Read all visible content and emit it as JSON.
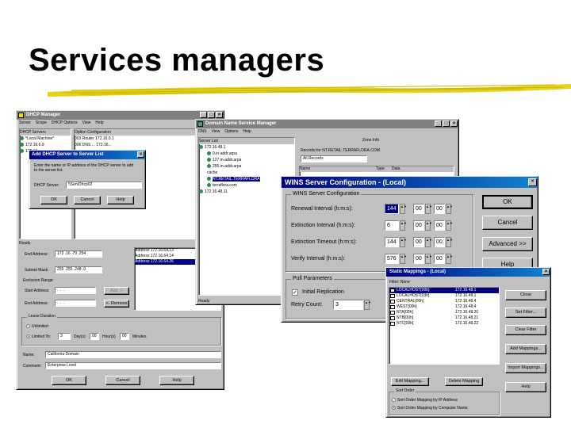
{
  "slide": {
    "title": "Services managers"
  },
  "dhcp": {
    "title": "DHCP Manager",
    "menu": [
      "Server",
      "Scope",
      "DHCP Options",
      "View",
      "Help"
    ],
    "pane_left": "DHCP Servers",
    "pane_right": "Option Configuration",
    "tree": [
      "*Local Machine*",
      "172.16.6.9",
      "172.16..."
    ],
    "options": [
      "003 Router 172.16.0.1",
      "006 DNS ... 172.16..."
    ],
    "status": "Ready",
    "end_address_label": "End Address:",
    "end_address": "172 .16 .79 .254",
    "subnet_label": "Subnet Mask:",
    "subnet": "255 .255 .248 .0",
    "exclusion_label": "Exclusion Range:",
    "start_label": "Start Address:",
    "end_label": "End Address:",
    "add": "Add ->",
    "remove": "<- Remove",
    "excluded": [
      "Address 172.16.64.13",
      "Address 172.16.64.14",
      "Address 172.16.64.26"
    ],
    "lease_label": "Lease Duration",
    "unlimited": "Unlimited",
    "limited": "Limited To:",
    "days": "3",
    "days_label": "Day(s)",
    "hours": "00",
    "hours_label": "Hour(s)",
    "minutes": "00",
    "minutes_label": "Minutes",
    "name_label": "Name:",
    "name": "California Domain",
    "comment_label": "Comment:",
    "comment": "Enterprise Level",
    "ok": "OK",
    "cancel": "Cancel",
    "help": "Help"
  },
  "add_dialog": {
    "title": "Add DHCP Server to Server List",
    "text": "Enter the name or IP address of the DHCP server to add to the server list.",
    "label": "DHCP Server:",
    "value": "\\\\ServDhcp02",
    "ok": "OK",
    "cancel": "Cancel",
    "help": "Help"
  },
  "dns": {
    "title": "Domain Name Service Manager",
    "menu": [
      "DNS",
      "View",
      "Options",
      "Help"
    ],
    "server_list": "Server List",
    "zone_info": "Zone Info",
    "tree": [
      "172.16.48.1",
      "0.in-addr.arpa",
      "127.in-addr.arpa",
      "255.in-addr.arpa",
      "cache",
      "NT.RETAIL.TERRAFLORA",
      "terraflora.com",
      "172.16.48.11"
    ],
    "records_for": "Records for NT.RETAIL.TERRAFLORA.COM",
    "all_records": "All Records",
    "col_name": "Name",
    "col_type": "Type",
    "col_data": "Data",
    "status": "Ready"
  },
  "wins": {
    "title": "WINS Server Configuration - (Local)",
    "group": "WINS Server Configuration",
    "renewal_label": "Renewal Interval (h:m:s):",
    "renewal": [
      "144",
      "00",
      "00"
    ],
    "extinction_label": "Extinction Interval (h:m:s):",
    "extinction": [
      "6",
      "00",
      "00"
    ],
    "timeout_label": "Extinction Timeout (h:m:s):",
    "timeout": [
      "144",
      "00",
      "00"
    ],
    "verify_label": "Verify Interval (h:m:s):",
    "verify": [
      "576",
      "00",
      "00"
    ],
    "pull_group": "Pull Parameters",
    "initial_label": "Initial Replication",
    "retry_label": "Retry Count:",
    "retry": "3",
    "ok": "OK",
    "cancel": "Cancel",
    "advanced": "Advanced >>",
    "help": "Help"
  },
  "static": {
    "title": "Static Mappings - (Local)",
    "filter": "Filter: None",
    "rows": [
      {
        "name": "LOCALHOST[00h]",
        "ip": "172.16.48.1"
      },
      {
        "name": "LOCALHOST[03h]",
        "ip": "172.16.48.1"
      },
      {
        "name": "CENTRAL[00h]",
        "ip": "172.16.48.4"
      },
      {
        "name": "WEST[00h]",
        "ip": "172.16.48.4"
      },
      {
        "name": "NTA[00h]",
        "ip": "172.16.48.20"
      },
      {
        "name": "NTB[00h]",
        "ip": "172.16.48.21"
      },
      {
        "name": "NTC[00h]",
        "ip": "172.16.48.22"
      }
    ],
    "close": "Close",
    "set_filter": "Set Filter...",
    "clear_filter": "Clear Filter",
    "add_mappings": "Add Mappings...",
    "import": "Import Mappings...",
    "help": "Help",
    "edit": "Edit Mapping...",
    "delete": "Delete Mapping",
    "sort_group": "Sort Order",
    "sort_ip": "Sort Order Mapping by IP Address",
    "sort_name": "Sort Order Mapping by Computer Name"
  }
}
